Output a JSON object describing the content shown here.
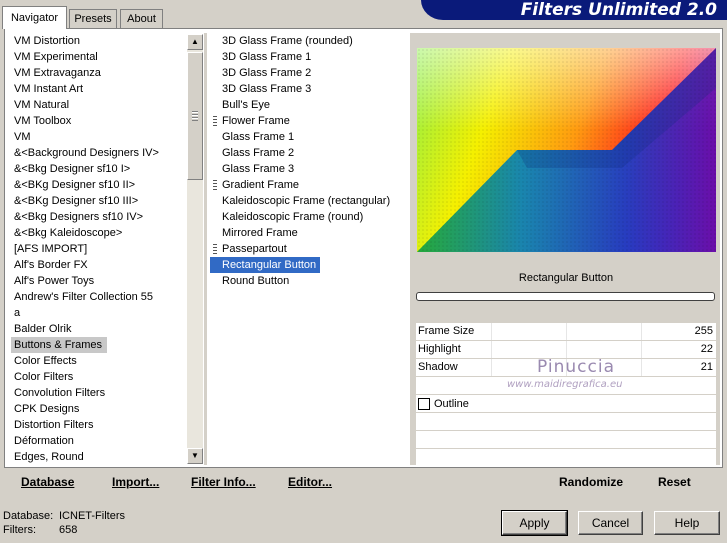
{
  "tabs": [
    "Navigator",
    "Presets",
    "About"
  ],
  "title": "Filters Unlimited 2.0",
  "categories": [
    "VM Distortion",
    "VM Experimental",
    "VM Extravaganza",
    "VM Instant Art",
    "VM Natural",
    "VM Toolbox",
    "VM",
    "&<Background Designers IV>",
    "&<Bkg Designer sf10 I>",
    "&<BKg Designer sf10 II>",
    "&<BKg Designer sf10 III>",
    "&<Bkg Designers sf10 IV>",
    "&<Bkg Kaleidoscope>",
    "[AFS IMPORT]",
    "Alf's Border FX",
    "Alf's Power Toys",
    "Andrew's Filter Collection 55",
    "a",
    "Balder Olrik",
    "Buttons & Frames",
    "Color Effects",
    "Color Filters",
    "Convolution Filters",
    "CPK Designs",
    "Distortion Filters",
    "Déformation",
    "Edges, Round"
  ],
  "selected_category": "Buttons & Frames",
  "filters": [
    {
      "label": "3D Glass Frame (rounded)",
      "grip": false
    },
    {
      "label": "3D Glass Frame 1",
      "grip": false
    },
    {
      "label": "3D Glass Frame 2",
      "grip": false
    },
    {
      "label": "3D Glass Frame 3",
      "grip": false
    },
    {
      "label": "Bull's Eye",
      "grip": false
    },
    {
      "label": "Flower Frame",
      "grip": true
    },
    {
      "label": "Glass Frame 1",
      "grip": false
    },
    {
      "label": "Glass Frame 2",
      "grip": false
    },
    {
      "label": "Glass Frame 3",
      "grip": false
    },
    {
      "label": "Gradient Frame",
      "grip": true
    },
    {
      "label": "Kaleidoscopic Frame (rectangular)",
      "grip": false
    },
    {
      "label": "Kaleidoscopic Frame (round)",
      "grip": false
    },
    {
      "label": "Mirrored Frame",
      "grip": false
    },
    {
      "label": "Passepartout",
      "grip": true
    },
    {
      "label": "Rectangular Button",
      "grip": false
    },
    {
      "label": "Round Button",
      "grip": false
    }
  ],
  "selected_filter": "Rectangular Button",
  "preview_label": "Rectangular Button",
  "params": [
    {
      "label": "Frame Size",
      "value": "255"
    },
    {
      "label": "Highlight",
      "value": "22"
    },
    {
      "label": "Shadow",
      "value": "21"
    }
  ],
  "outline": {
    "label": "Outline",
    "checked": false
  },
  "watermark": {
    "name": "Pinuccia",
    "url": "www.maidiregrafica.eu"
  },
  "toolbar": {
    "database": "Database",
    "import": "Import...",
    "filter_info": "Filter Info...",
    "editor": "Editor...",
    "randomize": "Randomize",
    "reset": "Reset"
  },
  "status": {
    "database_label": "Database:",
    "database_value": "ICNET-Filters",
    "filters_label": "Filters:",
    "filters_value": "658"
  },
  "buttons": {
    "apply": "Apply",
    "cancel": "Cancel",
    "help": "Help"
  }
}
